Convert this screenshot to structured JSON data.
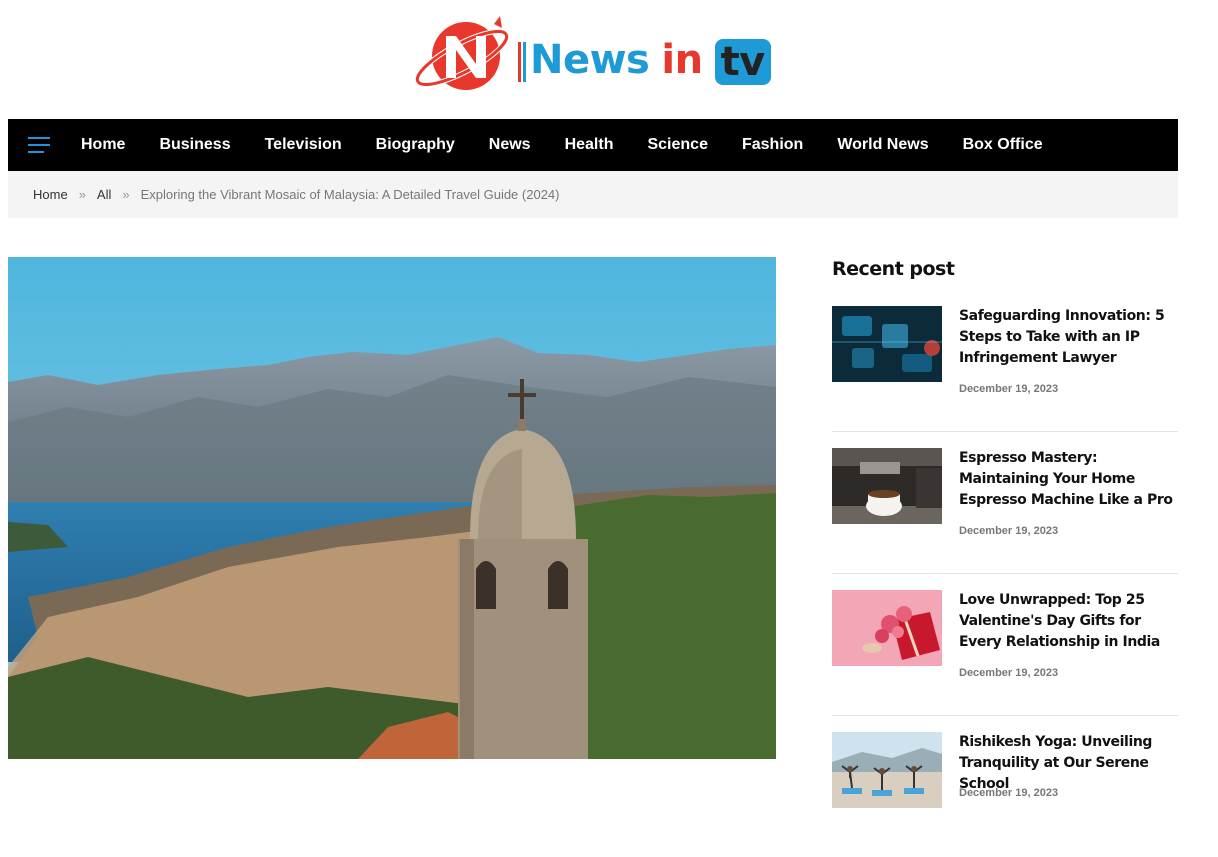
{
  "brand": {
    "logo_icon": "globe-n-logo-icon",
    "word1": "News",
    "word2": "in",
    "word3": "tv",
    "colors": {
      "blue": "#1e9ad6",
      "red": "#e8382c"
    }
  },
  "nav": {
    "menu_icon": "hamburger-menu-icon",
    "items": [
      {
        "label": "Home"
      },
      {
        "label": "Business"
      },
      {
        "label": "Television"
      },
      {
        "label": "Biography"
      },
      {
        "label": "News"
      },
      {
        "label": "Health"
      },
      {
        "label": "Science"
      },
      {
        "label": "Fashion"
      },
      {
        "label": "World News"
      },
      {
        "label": "Box Office"
      }
    ]
  },
  "breadcrumb": {
    "home": "Home",
    "all": "All",
    "separator": "»",
    "current": "Exploring the Vibrant Mosaic of Malaysia: A Detailed Travel Guide (2024)"
  },
  "hero": {
    "image_icon": "mountain-bay-bell-tower-photo"
  },
  "sidebar": {
    "title": "Recent post",
    "posts": [
      {
        "title": "Safeguarding Innovation: 5 Steps to Take with an IP Infringement Lawyer",
        "date": "December 19, 2023",
        "thumb_icon": "digital-circuit-thumbnail"
      },
      {
        "title": "Espresso Mastery: Maintaining Your Home Espresso Machine Like a Pro",
        "date": "December 19, 2023",
        "thumb_icon": "espresso-machine-thumbnail"
      },
      {
        "title": "Love Unwrapped: Top 25 Valentine's Day Gifts for Every Relationship in India",
        "date": "December 19, 2023",
        "thumb_icon": "roses-gift-box-thumbnail"
      },
      {
        "title": "Rishikesh Yoga: Unveiling Tranquility at Our Serene School",
        "date": "December 19, 2023",
        "thumb_icon": "yoga-group-thumbnail"
      }
    ]
  }
}
